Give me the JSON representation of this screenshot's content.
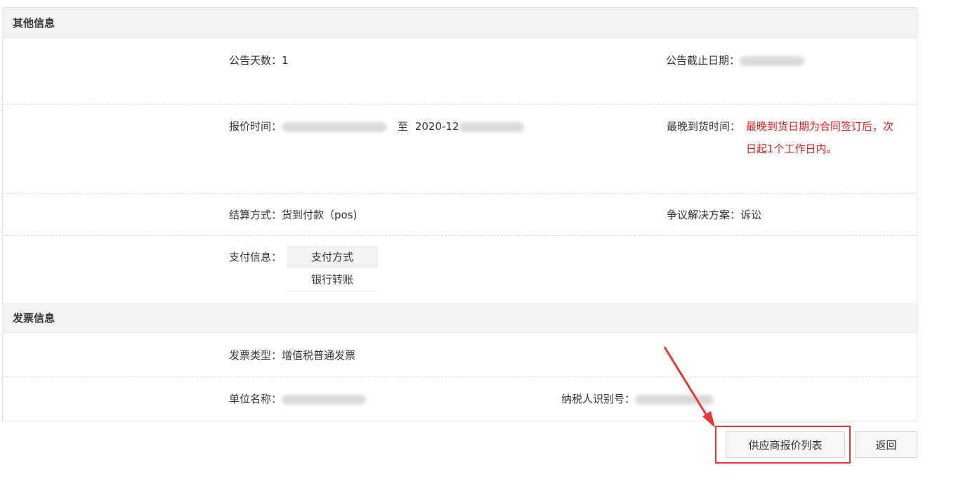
{
  "other_info": {
    "title": "其他信息",
    "announce_days_label": "公告天数：",
    "announce_days_value": "1",
    "announce_deadline_label": "公告截止日期：",
    "quote_time_label": "报价时间：",
    "quote_time_sep": "至",
    "quote_time_end_prefix": "2020-12",
    "latest_delivery_label": "最晚到货时间：",
    "latest_delivery_value_line1": "最晚到货日期为合同签订后，次",
    "latest_delivery_value_line2": "日起1个工作日内。",
    "settlement_label": "结算方式：",
    "settlement_value": "货到付款（pos)",
    "dispute_label": "争议解决方案：",
    "dispute_value": "诉讼",
    "payment_info_label": "支付信息：",
    "payment_table_header": "支付方式",
    "payment_table_value": "银行转账"
  },
  "invoice_info": {
    "title": "发票信息",
    "invoice_type_label": "发票类型：",
    "invoice_type_value": "增值税普通发票",
    "company_name_label": "单位名称：",
    "taxpayer_id_label": "纳税人识别号："
  },
  "actions": {
    "supplier_quote_list": "供应商报价列表",
    "back": "返回"
  },
  "colors": {
    "highlight": "#e53935",
    "emphasis_text": "#e01b1b"
  }
}
